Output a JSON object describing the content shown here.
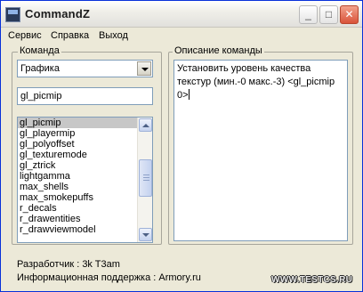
{
  "window": {
    "title": "CommandZ",
    "minimize_glyph": "_",
    "maximize_glyph": "□",
    "close_glyph": "✕"
  },
  "menu": {
    "service": "Сервис",
    "help": "Справка",
    "exit": "Выход"
  },
  "command_group": {
    "label": "Команда",
    "category_selected": "Графика",
    "search_value": "gl_picmip",
    "list_items": [
      "gl_picmip",
      "gl_playermip",
      "gl_polyoffset",
      "gl_texturemode",
      "gl_ztrick",
      "lightgamma",
      "max_shells",
      "max_smokepuffs",
      "r_decals",
      "r_drawentities",
      "r_drawviewmodel"
    ],
    "selected_item": "gl_picmip"
  },
  "description_group": {
    "label": "Описание команды",
    "text": "Установить уровень качества текстур (мин.-0 макс.-3) <gl_picmip 0>"
  },
  "footer": {
    "author": "Разработчик : 3k T3am",
    "support": "Информационная поддержка : Armory.ru"
  },
  "watermark": "WWW.TESTCS.RU",
  "colors": {
    "window_bg": "#ece9d8",
    "selection_bg": "#c7c7c7",
    "field_border": "#7f9db9",
    "close_button": "#d9533a"
  }
}
